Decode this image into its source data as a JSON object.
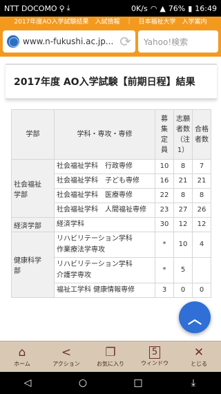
{
  "status_bar": {
    "carrier": "NTT DOCOMO",
    "speed": "0K/s",
    "battery": "76%",
    "time": "16:49",
    "icons": [
      "usb-icon",
      "download-icon",
      "wifi-icon",
      "signal-icon",
      "battery-icon"
    ]
  },
  "browser": {
    "tab_title": "2017年度AO入学試験結果　入試情報　｜　日本福祉大学　入学案内",
    "url": "www.n-fukushi.ac.jp...",
    "search_placeholder": "Yahoo!検索",
    "accent_color": "#f39a1e"
  },
  "page": {
    "heading": "2017年度 AO入学試験【前期日程】結果",
    "table": {
      "headers": {
        "dept": "学部",
        "major": "学科・専攻・専修",
        "capacity": "募\n集\n定\n員",
        "applicants": "志願\n者数\n（注\n1）",
        "passed": "合格\n者数"
      },
      "groups": [
        {
          "dept": "社会福祉\n学部",
          "rows": [
            {
              "major": "社会福祉学科　行政専修",
              "capacity": "10",
              "applicants": "8",
              "passed": "7"
            },
            {
              "major": "社会福祉学科　子ども専修",
              "capacity": "16",
              "applicants": "21",
              "passed": "21"
            },
            {
              "major": "社会福祉学科　医療専修",
              "capacity": "22",
              "applicants": "8",
              "passed": "8"
            },
            {
              "major": "社会福祉学科　人間福祉専修",
              "capacity": "23",
              "applicants": "27",
              "passed": "26"
            }
          ]
        },
        {
          "dept": "経済学部",
          "rows": [
            {
              "major": "経済学科",
              "capacity": "30",
              "applicants": "12",
              "passed": "12"
            }
          ]
        },
        {
          "dept": "健康科学\n部",
          "rows": [
            {
              "major": "リハビリテーション学科\n作業療法学専攻",
              "capacity": "*",
              "applicants": "10",
              "passed": "4"
            },
            {
              "major": "リハビリテーション学科\n介護学専攻",
              "capacity": "*",
              "applicants": "5",
              "passed": ""
            },
            {
              "major": "福祉工学科 健康情報専修",
              "capacity": "3",
              "applicants": "0",
              "passed": "0"
            }
          ]
        }
      ]
    }
  },
  "fab": {
    "icon": "chevron-up-icon"
  },
  "app_toolbar": {
    "items": [
      {
        "icon": "home-icon",
        "label": "ホーム"
      },
      {
        "icon": "share-icon",
        "label": "アクション"
      },
      {
        "icon": "favorite-icon",
        "label": "お気に入り"
      },
      {
        "icon": "window-icon",
        "label": "ウィンドウ",
        "badge": "5"
      },
      {
        "icon": "close-icon",
        "label": "とじる"
      }
    ]
  },
  "nav_bar": {
    "buttons": [
      "back-icon",
      "home-icon",
      "recents-icon",
      "notification-icon"
    ]
  }
}
